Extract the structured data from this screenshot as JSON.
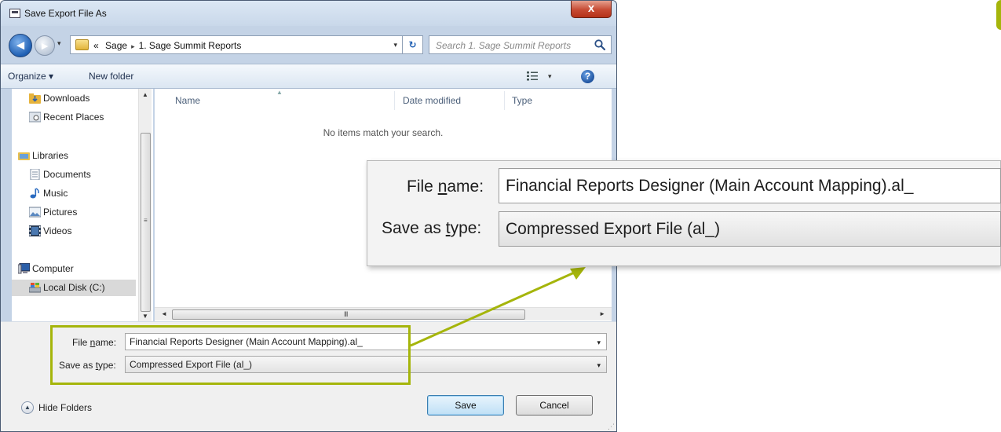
{
  "window": {
    "title": "Save Export File As",
    "close_label": "x"
  },
  "nav": {
    "back_glyph": "◄",
    "forward_glyph": "►",
    "history_glyph": "▾",
    "breadcrumb": {
      "overflow": "«",
      "items": [
        "Sage",
        "1. Sage Summit Reports"
      ],
      "separator": "▸"
    },
    "address_dropdown_glyph": "▾",
    "refresh_glyph": "↻",
    "search": {
      "placeholder": "Search 1. Sage Summit Reports"
    }
  },
  "toolbar": {
    "organize_label": "Organize ▾",
    "new_folder_label": "New folder",
    "views_dropdown_glyph": "▾",
    "help_label": "?"
  },
  "sidebar": {
    "items": [
      {
        "label": "Downloads",
        "icon": "downloads-icon"
      },
      {
        "label": "Recent Places",
        "icon": "recent-places-icon"
      },
      {
        "label": "Libraries",
        "icon": "libraries-icon"
      },
      {
        "label": "Documents",
        "icon": "documents-icon"
      },
      {
        "label": "Music",
        "icon": "music-icon"
      },
      {
        "label": "Pictures",
        "icon": "pictures-icon"
      },
      {
        "label": "Videos",
        "icon": "videos-icon"
      },
      {
        "label": "Computer",
        "icon": "computer-icon"
      },
      {
        "label": "Local Disk (C:)",
        "icon": "local-disk-icon"
      }
    ],
    "selected": "Local Disk (C:)"
  },
  "file_list": {
    "columns": [
      "Name",
      "Date modified",
      "Type"
    ],
    "empty_message": "No items match your search."
  },
  "scrollbar_glyphs": {
    "up": "▲",
    "down": "▼",
    "left": "◄",
    "right": "►",
    "vgrip": "≡",
    "hgrip": "III"
  },
  "form": {
    "file_name": {
      "label_pre": "File ",
      "label_u": "n",
      "label_post": "ame:",
      "value": "Financial Reports Designer (Main Account Mapping).al_",
      "dropdown_glyph": "▾"
    },
    "save_as_type": {
      "label_pre": "Save as ",
      "label_u": "t",
      "label_post": "ype:",
      "value": "Compressed Export File (al_)",
      "dropdown_glyph": "▾"
    }
  },
  "footer": {
    "hide_folders_glyph": "▲",
    "hide_folders_label": "Hide Folders",
    "save_label": "Save",
    "cancel_label": "Cancel",
    "resize_glyph": "⋰"
  },
  "annotation": {
    "highlight_color": "#a5b50b"
  }
}
